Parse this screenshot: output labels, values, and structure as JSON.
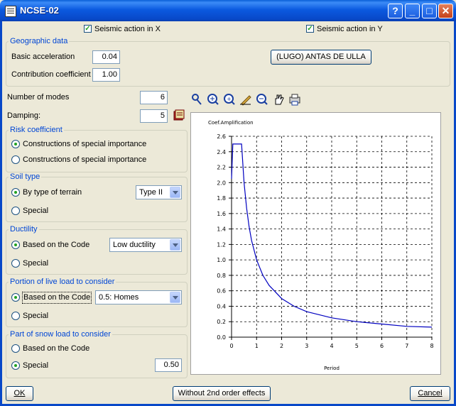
{
  "window": {
    "title": "NCSE-02",
    "help": "?",
    "minimize": "_",
    "maximize": "□",
    "close": "✕"
  },
  "top": {
    "seismic_x": {
      "label": "Seismic action in X",
      "checked": true
    },
    "seismic_y": {
      "label": "Seismic action in Y",
      "checked": true
    }
  },
  "geographic": {
    "title": "Geographic data",
    "basic_acceleration_label": "Basic acceleration",
    "basic_acceleration_value": "0.04",
    "contribution_label": "Contribution coefficient",
    "contribution_value": "1.00",
    "location_button": "(LUGO) ANTAS DE ULLA"
  },
  "modes": {
    "label": "Number of modes",
    "value": "6"
  },
  "damping": {
    "label": "Damping:",
    "value": "5"
  },
  "risk": {
    "title": "Risk coefficient",
    "options": [
      "Constructions of special importance",
      "Constructions of special importance"
    ],
    "selected": 0
  },
  "soil": {
    "title": "Soil type",
    "option1": "By type of terrain",
    "option2": "Special",
    "select_value": "Type II"
  },
  "ductility": {
    "title": "Ductility",
    "option1": "Based on the Code",
    "option2": "Special",
    "select_value": "Low ductility"
  },
  "live_load": {
    "title": "Portion of live load to consider",
    "option1": "Based on the Code",
    "option2": "Special",
    "select_value": "0.5: Homes"
  },
  "snow_load": {
    "title": "Part of snow load to consider",
    "option1": "Based on the Code",
    "option2": "Special",
    "special_value": "0.50"
  },
  "footer": {
    "ok": "OK",
    "order": "Without 2nd order effects",
    "cancel": "Cancel"
  },
  "colors": {
    "accent": "#0046d5",
    "curve": "#0000c0",
    "check": "#21a121"
  },
  "chart_data": {
    "type": "line",
    "ylabel": "Coef.Amplification",
    "xlabel": "Period",
    "xlim": [
      0,
      8
    ],
    "ylim": [
      0,
      2.6
    ],
    "xticks": [
      "0",
      "1",
      "2",
      "3",
      "4",
      "5",
      "6",
      "7",
      "8"
    ],
    "yticks": [
      "0.0",
      "0.2",
      "0.4",
      "0.6",
      "0.8",
      "1.0",
      "1.2",
      "1.4",
      "1.6",
      "1.8",
      "2.0",
      "2.2",
      "2.4",
      "2.6"
    ],
    "grid": true,
    "series": [
      {
        "x": [
          0,
          0.05,
          0.1,
          0.15,
          0.4,
          0.5,
          0.6,
          0.7,
          0.8,
          1.0,
          1.25,
          1.5,
          2.0,
          2.5,
          3.0,
          3.5,
          4.0,
          5.0,
          6.0,
          7.0,
          8.0
        ],
        "values": [
          2.05,
          2.5,
          2.5,
          2.5,
          2.5,
          2.0,
          1.67,
          1.43,
          1.25,
          1.0,
          0.8,
          0.67,
          0.5,
          0.4,
          0.33,
          0.29,
          0.25,
          0.2,
          0.17,
          0.14,
          0.13
        ]
      }
    ]
  }
}
